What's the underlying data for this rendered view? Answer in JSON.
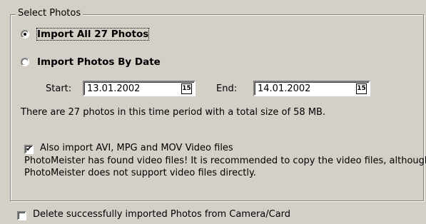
{
  "group": {
    "title": "Select Photos"
  },
  "options": {
    "import_all": {
      "label": "Import All 27 Photos",
      "selected": true
    },
    "import_by_date": {
      "label": "Import Photos By Date",
      "selected": false
    }
  },
  "date_range": {
    "start_label": "Start:",
    "start_value": "13.01.2002",
    "end_label": "End:",
    "end_value": "14.01.2002",
    "calendar_icon_text": "15"
  },
  "summary_text": "There are 27 photos in this time period with a total size of 58 MB.",
  "video": {
    "checkbox_label": "Also import AVI, MPG and MOV Video files",
    "checked": true,
    "note_line1": "PhotoMeister has found video files! It is recommended to copy the video files, although",
    "note_line2": "PhotoMeister does not support video files directly."
  },
  "delete_option": {
    "label": "Delete successfully imported Photos from Camera/Card",
    "checked": false
  },
  "icons": {
    "calendar": "calendar-icon",
    "checkmark": "✔"
  }
}
